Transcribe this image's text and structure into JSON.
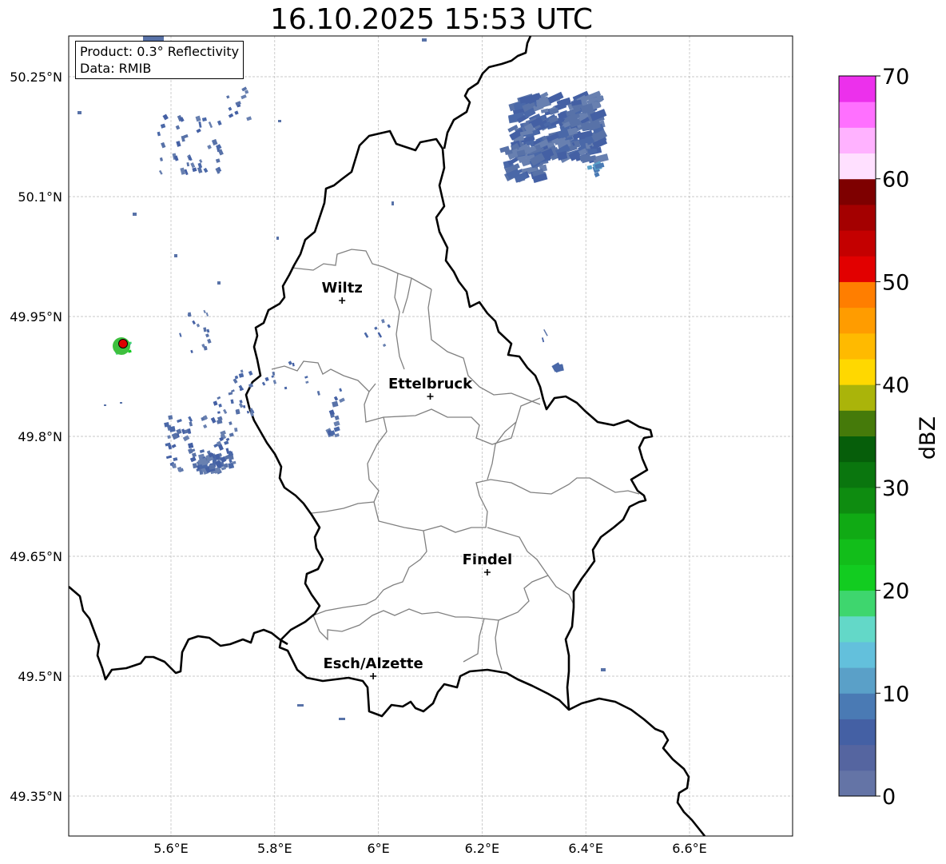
{
  "title": "16.10.2025 15:53 UTC",
  "info": {
    "product": "Product: 0.3° Reflectivity",
    "data": "Data: RMIB"
  },
  "axes": {
    "lon_ticks": [
      "5.6°E",
      "5.8°E",
      "6°E",
      "6.2°E",
      "6.4°E",
      "6.6°E"
    ],
    "lat_ticks": [
      "50.25°N",
      "50.1°N",
      "49.95°N",
      "49.8°N",
      "49.65°N",
      "49.5°N",
      "49.35°N"
    ],
    "lon_range": [
      5.4,
      6.8
    ],
    "lat_range": [
      49.3,
      50.3
    ]
  },
  "cities": [
    {
      "name": "Wiltz",
      "lon": 5.93,
      "lat": 49.97
    },
    {
      "name": "Ettelbruck",
      "lon": 6.1,
      "lat": 49.85
    },
    {
      "name": "Findel",
      "lon": 6.21,
      "lat": 49.63
    },
    {
      "name": "Esch/Alzette",
      "lon": 5.99,
      "lat": 49.5
    }
  ],
  "radar_site": {
    "lon": 5.51,
    "lat": 49.915,
    "color": "#dd0000"
  },
  "colorbar": {
    "label": "dBZ",
    "ticks": [
      "0",
      "10",
      "20",
      "30",
      "40",
      "50",
      "60",
      "70"
    ],
    "range": [
      0,
      70
    ],
    "colors": [
      "#6474a6",
      "#5565a0",
      "#4460a4",
      "#4a7ab4",
      "#5aa0c8",
      "#63c0dc",
      "#63d8c8",
      "#3ed66e",
      "#12cc20",
      "#12be1a",
      "#10aa14",
      "#0e8c10",
      "#0a760e",
      "#065e0a",
      "#457a0a",
      "#aab40a",
      "#ffd800",
      "#ffba00",
      "#ff9c00",
      "#ff7e00",
      "#e20000",
      "#c40000",
      "#a40000",
      "#7e0000",
      "#ffe0ff",
      "#ffb2ff",
      "#ff70ff",
      "#ec30ec"
    ]
  },
  "colors": {
    "border_national": "#000000",
    "border_canton": "#808080",
    "echo": "#5872a8"
  }
}
